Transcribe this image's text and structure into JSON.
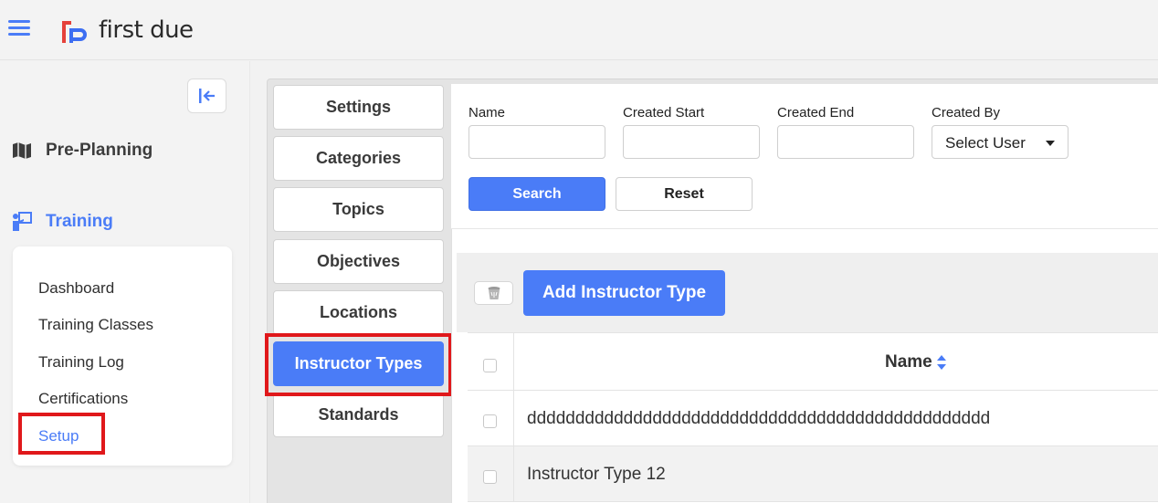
{
  "brand": {
    "name": "first due",
    "accent": "#4a7cf7",
    "highlight": "#e0181b"
  },
  "sidebar": {
    "sections": [
      {
        "label": "Pre-Planning",
        "icon": "map-icon"
      },
      {
        "label": "Training",
        "icon": "training-icon"
      }
    ],
    "training_items": [
      {
        "label": "Dashboard"
      },
      {
        "label": "Training Classes"
      },
      {
        "label": "Training Log"
      },
      {
        "label": "Certifications"
      },
      {
        "label": "Setup",
        "active": true
      }
    ]
  },
  "tabs": [
    {
      "label": "Settings"
    },
    {
      "label": "Categories"
    },
    {
      "label": "Topics"
    },
    {
      "label": "Objectives"
    },
    {
      "label": "Locations"
    },
    {
      "label": "Instructor Types",
      "active": true
    },
    {
      "label": "Standards"
    }
  ],
  "filters": {
    "name_label": "Name",
    "created_start_label": "Created Start",
    "created_end_label": "Created End",
    "created_by_label": "Created By",
    "created_by_value": "Select User",
    "search_label": "Search",
    "reset_label": "Reset"
  },
  "toolbar": {
    "add_label": "Add Instructor Type"
  },
  "table": {
    "header": "Name",
    "rows": [
      {
        "name": "dddddddddddddddddddddddddddddddddddddddddddddddd"
      },
      {
        "name": "Instructor Type 12"
      }
    ]
  }
}
